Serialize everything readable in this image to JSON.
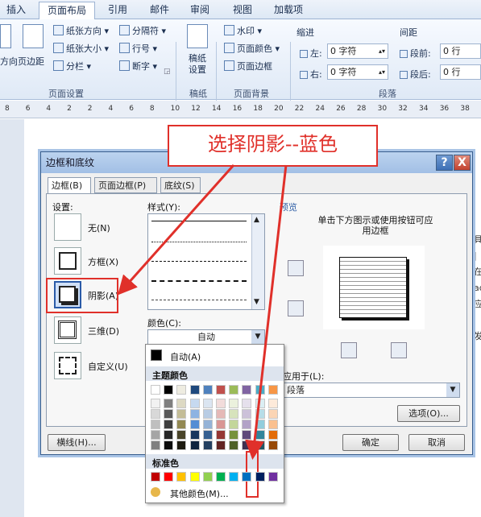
{
  "ribbon": {
    "tabs": [
      "插入",
      "页面布局",
      "引用",
      "邮件",
      "审阅",
      "视图",
      "加载项"
    ],
    "direction": "方向",
    "margins": "页边距",
    "paper_orientation": "纸张方向",
    "paper_size": "纸张大小",
    "columns": "分栏",
    "breaks": "分隔符",
    "line_numbers": "行号",
    "hyphenation": "断字",
    "page_setup": "页面设置",
    "draft_paper": "稿纸设置",
    "draft": "稿纸",
    "watermark": "水印",
    "page_color": "页面颜色",
    "page_borders": "页面边框",
    "page_background": "页面背景",
    "indent": "缩进",
    "left": "左:",
    "right": "右:",
    "left_value": "0 字符",
    "right_value": "0 字符",
    "spacing": "间距",
    "before": "段前:",
    "after": "段后:",
    "before_value": "0 行",
    "after_value": "0 行",
    "paragraph": "段落"
  },
  "ruler": {
    "numbers": [
      "8",
      "6",
      "4",
      "2",
      "2",
      "4",
      "6",
      "8",
      "10",
      "12",
      "14",
      "16",
      "18",
      "20",
      "22",
      "24",
      "26",
      "28",
      "30",
      "32",
      "34",
      "36",
      "38"
    ]
  },
  "callout": "选择阴影--蓝色",
  "dialog": {
    "title": "边框和底纹",
    "help": "?",
    "close": "X",
    "tabs": [
      "边框(B)",
      "页面边框(P)",
      "底纹(S)"
    ],
    "setting_label": "设置:",
    "settings": [
      "无(N)",
      "方框(X)",
      "阴影(A)",
      "三维(D)",
      "自定义(U)"
    ],
    "style_label": "样式(Y):",
    "color_label": "颜色(C):",
    "color_value": "自动",
    "preview_label": "预览",
    "preview_hint": "单击下方图示或使用按钮可应用边框",
    "apply_label": "应用于(L):",
    "apply_value": "段落",
    "options_button": "选项(O)...",
    "hline_button": "横线(H)...",
    "ok_button": "确定",
    "cancel_button": "取消"
  },
  "palette": {
    "auto": "自动(A)",
    "theme_colors": "主题颜色",
    "standard_colors": "标准色",
    "more_colors": "其他颜色(M)...",
    "theme_top": [
      "#ffffff",
      "#000000",
      "#eeece1",
      "#1f497d",
      "#4f81bd",
      "#c0504d",
      "#9bbb59",
      "#8064a2",
      "#4bacc6",
      "#f79646"
    ],
    "theme_shades": [
      [
        "#f2f2f2",
        "#7f7f7f",
        "#ddd9c3",
        "#c6d9f0",
        "#dbe5f1",
        "#f2dcdb",
        "#ebf1dd",
        "#e5e0ec",
        "#dbeef3",
        "#fdeada"
      ],
      [
        "#d8d8d8",
        "#595959",
        "#c4bd97",
        "#8db3e2",
        "#b8cce4",
        "#e5b9b7",
        "#d7e3bc",
        "#ccc1d9",
        "#b7dde8",
        "#fbd5b5"
      ],
      [
        "#bfbfbf",
        "#3f3f3f",
        "#938953",
        "#548dd4",
        "#95b3d7",
        "#d99694",
        "#c3d69b",
        "#b2a2c7",
        "#92cddc",
        "#fac08f"
      ],
      [
        "#a5a5a5",
        "#262626",
        "#494429",
        "#17365d",
        "#366092",
        "#953734",
        "#76923c",
        "#5f497a",
        "#31859b",
        "#e36c09"
      ],
      [
        "#7f7f7f",
        "#0c0c0c",
        "#1d1b10",
        "#0f243e",
        "#244061",
        "#632423",
        "#4f6128",
        "#3f3151",
        "#205867",
        "#974806"
      ]
    ],
    "standard": [
      "#c00000",
      "#ff0000",
      "#ffc000",
      "#ffff00",
      "#92d050",
      "#00b050",
      "#00b0f0",
      "#0070c0",
      "#002060",
      "#7030a0"
    ]
  },
  "doc_side_text": [
    "具",
    "|",
    "在",
    "ad",
    "应",
    "",
    "发"
  ]
}
